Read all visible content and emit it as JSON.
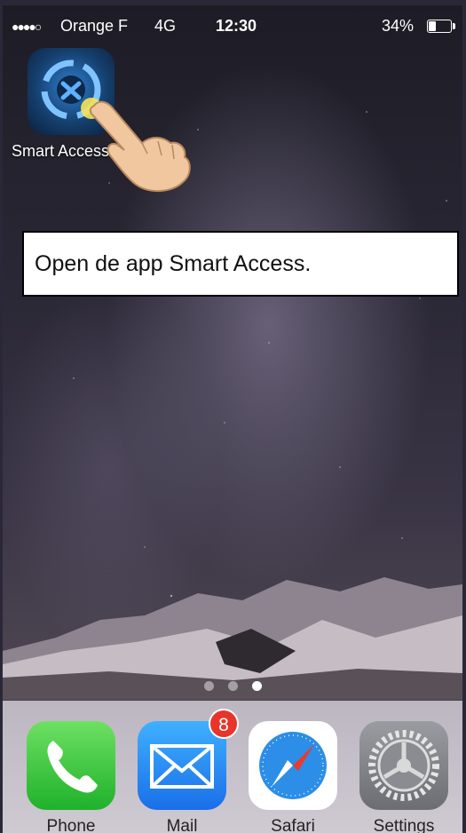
{
  "status_bar": {
    "signal": "●●●●○",
    "carrier": "Orange F",
    "network": "4G",
    "time": "12:30",
    "battery_percent": "34%",
    "battery_level": 0.34
  },
  "home_app": {
    "label": "Smart Access",
    "icon": "smart-access-icon"
  },
  "instruction": {
    "text": "Open de app Smart Access."
  },
  "page_indicator": {
    "pages": 3,
    "active_page": 3
  },
  "dock": {
    "apps": [
      {
        "label": "Phone",
        "icon": "phone-icon"
      },
      {
        "label": "Mail",
        "icon": "mail-icon",
        "badge": "8"
      },
      {
        "label": "Safari",
        "icon": "safari-icon"
      },
      {
        "label": "Settings",
        "icon": "settings-icon"
      }
    ]
  }
}
